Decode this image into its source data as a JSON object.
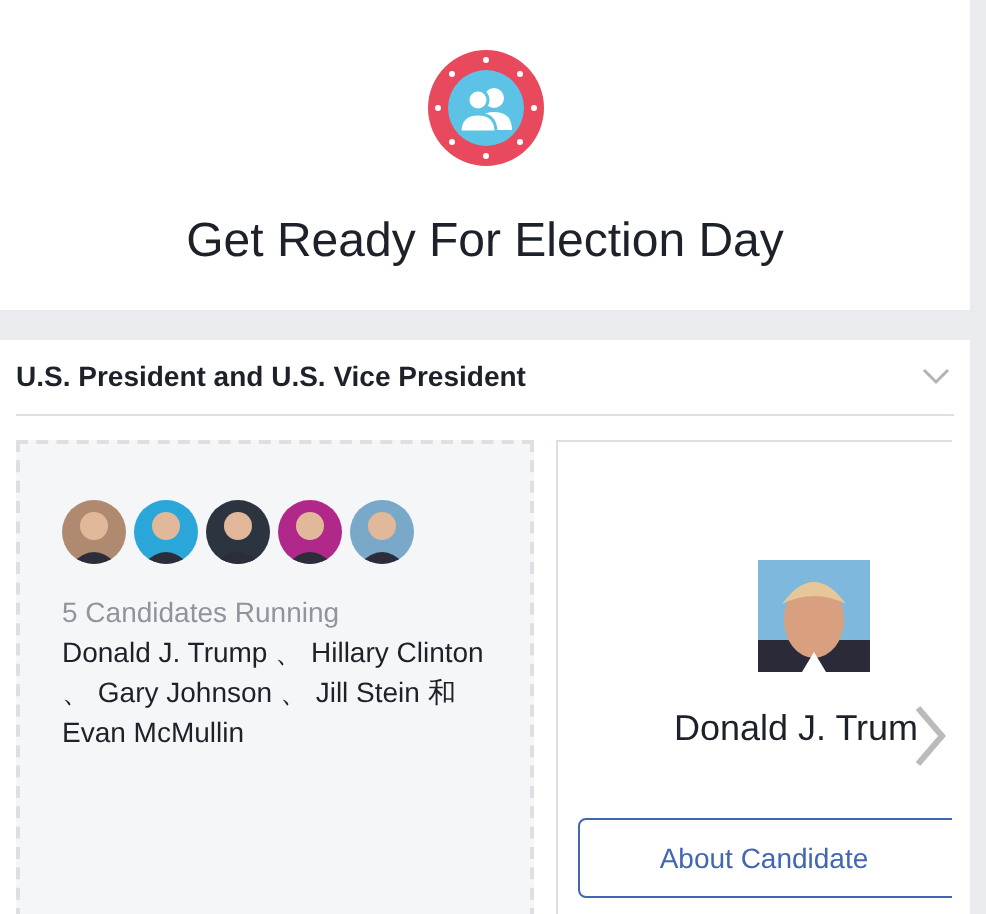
{
  "header": {
    "title": "Get Ready For Election Day"
  },
  "section": {
    "title": "U.S. President and U.S. Vice President",
    "expanded": true,
    "summary": {
      "count": "5 Candidates Running",
      "names": "Donald J. Trump 、 Hillary Clinton 、 Gary Johnson 、 Jill Stein 和 Evan McMullin"
    },
    "candidate": {
      "name": "Donald J. Trum",
      "button": "About Candidate"
    }
  }
}
